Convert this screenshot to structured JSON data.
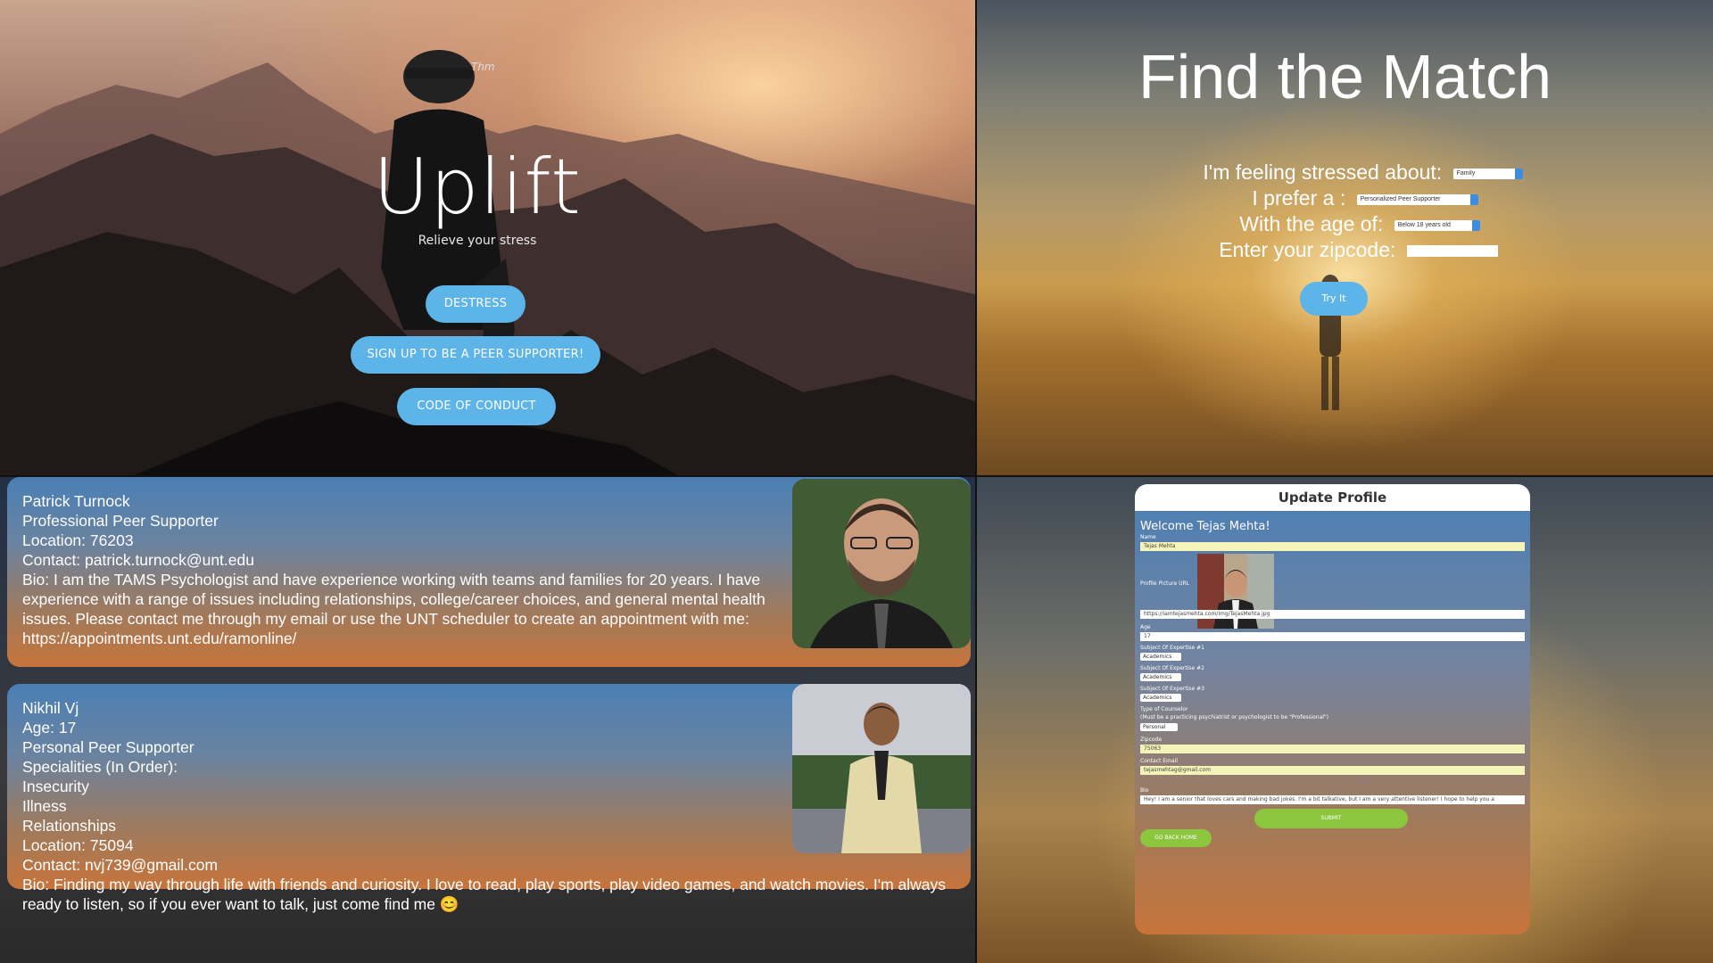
{
  "hero": {
    "title": "Uplift",
    "subtitle": "Relieve your stress",
    "cap_logo_text": "Thm",
    "buttons": {
      "destress": "DESTRESS",
      "signup": "SIGN UP TO BE A PEER SUPPORTER!",
      "conduct": "CODE OF CONDUCT"
    }
  },
  "match": {
    "title": "Find the Match",
    "stressed_label": "I'm feeling stressed about:",
    "stressed_value": "Family",
    "prefer_label": "I prefer a :",
    "prefer_value": "Personalized Peer Supporter",
    "age_label": "With the age of:",
    "age_value": "Below 18 years old",
    "zip_label": "Enter your zipcode:",
    "zip_value": "",
    "try_button": "Try It"
  },
  "supporters": [
    {
      "lines": [
        "Patrick Turnock",
        "Professional Peer Supporter",
        "Location: 76203",
        "Contact: patrick.turnock@unt.edu",
        "Bio: I am the TAMS Psychologist and have experience working with teams and families for 20 years. I have experience with a range of issues including relationships, college/career choices, and general mental health issues. Please contact me through my email or use the UNT scheduler to create an appointment with me: https://appointments.unt.edu/ramonline/"
      ]
    },
    {
      "lines": [
        "Nikhil Vj",
        "Age: 17",
        "Personal Peer Supporter",
        "Specialities (In Order):",
        "Insecurity",
        "Illness",
        "Relationships",
        "Location: 75094",
        "Contact: nvj739@gmail.com",
        "Bio: Finding my way through life with friends and curiosity. I love to read, play sports, play video games, and watch movies. I'm always ready to listen, so if you ever want to talk, just come find me 😊"
      ]
    }
  ],
  "profile": {
    "header": "Update Profile",
    "welcome": "Welcome Tejas Mehta!",
    "name_label": "Name",
    "name_value": "Tejas Mehta",
    "pic_label": "Profile Picture URL",
    "pic_value": "https://iamtejasmehta.com/img/TejasMehta.jpg",
    "age_label": "Age",
    "age_value": "17",
    "exp1_label": "Subject Of Expertise #1",
    "exp1_value": "Academics",
    "exp2_label": "Subject Of Expertise #2",
    "exp2_value": "Academics",
    "exp3_label": "Subject Of Expertise #3",
    "exp3_value": "Academics",
    "counselor_label": "Type of Counselor",
    "counselor_note": "(Must be a practicing psychiatrist or psychologist to be \"Professional\")",
    "counselor_value": "Personal",
    "zip_label": "Zipcode",
    "zip_value": "75063",
    "email_label": "Contact Email",
    "email_value": "tejasmehtag@gmail.com",
    "bio_label": "Bio",
    "bio_value": "Hey! I am a senior that loves cars and making bad jokes. I'm a bit talkative, but I am a very attentive listener! I hope to help you a",
    "submit": "SUBMIT",
    "go_home": "GO BACK HOME"
  },
  "colors": {
    "accent_blue": "#5db4e8",
    "submit_green": "#8cc63f"
  }
}
